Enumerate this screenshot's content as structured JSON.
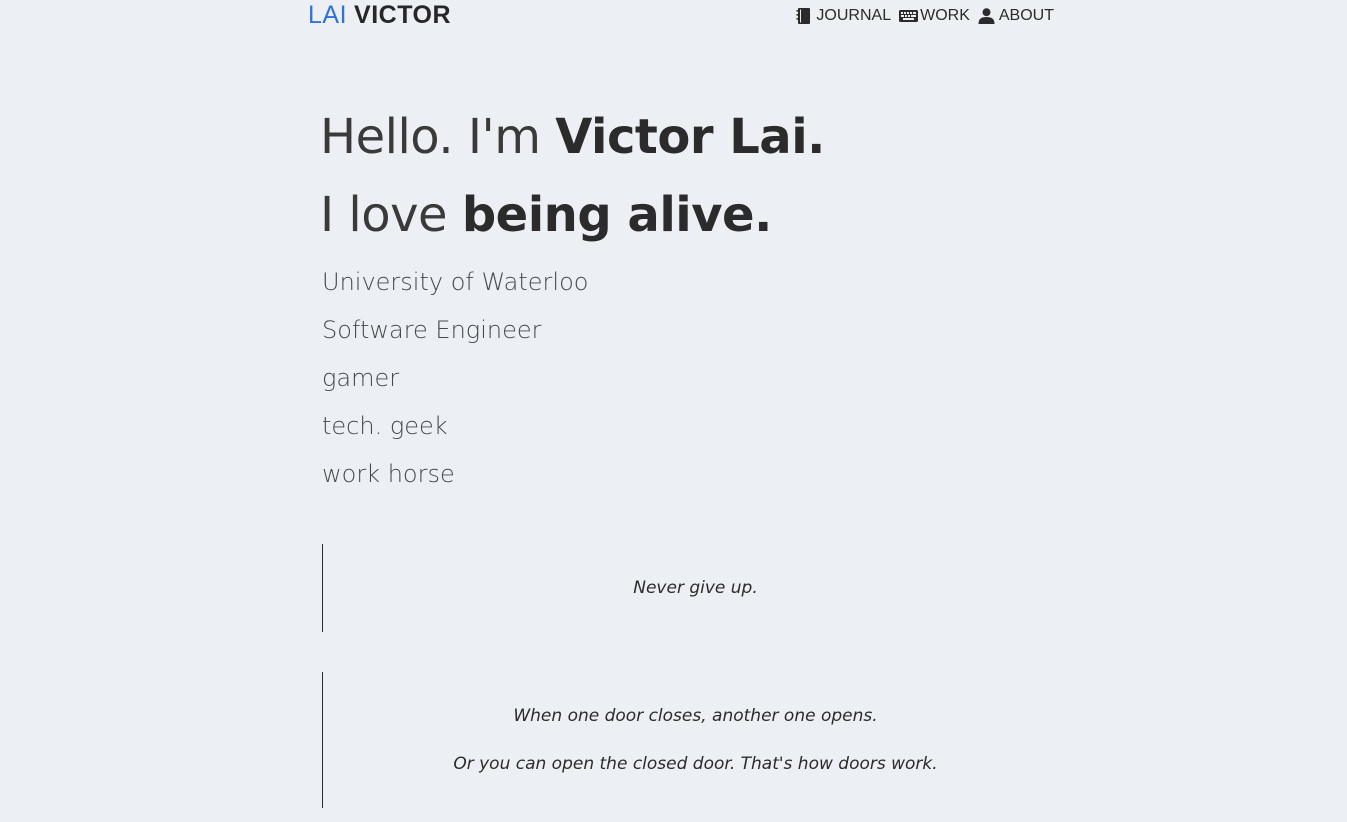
{
  "header": {
    "logo": {
      "first": "LAI",
      "last": "VICTOR"
    },
    "nav": [
      {
        "label": "JOURNAL",
        "icon": "journal-icon"
      },
      {
        "label": "WORK",
        "icon": "keyboard-icon"
      },
      {
        "label": "ABOUT",
        "icon": "user-icon"
      }
    ]
  },
  "hero": {
    "line1": {
      "prefix": "Hello. I'm ",
      "emphasis": "Victor Lai."
    },
    "line2": {
      "prefix": "I love ",
      "emphasis": "being alive."
    }
  },
  "traits": [
    "University of Waterloo",
    "Software Engineer",
    "gamer",
    "tech. geek",
    "work horse"
  ],
  "quotes": [
    {
      "lines": [
        "Never give up."
      ]
    },
    {
      "lines": [
        "When one door closes, another one opens.",
        "Or you can open the closed door. That's how doors work."
      ]
    }
  ],
  "colors": {
    "background": "#ecf0f4",
    "brand_blue": "#2f73d8",
    "text": "#2b2b2b"
  }
}
